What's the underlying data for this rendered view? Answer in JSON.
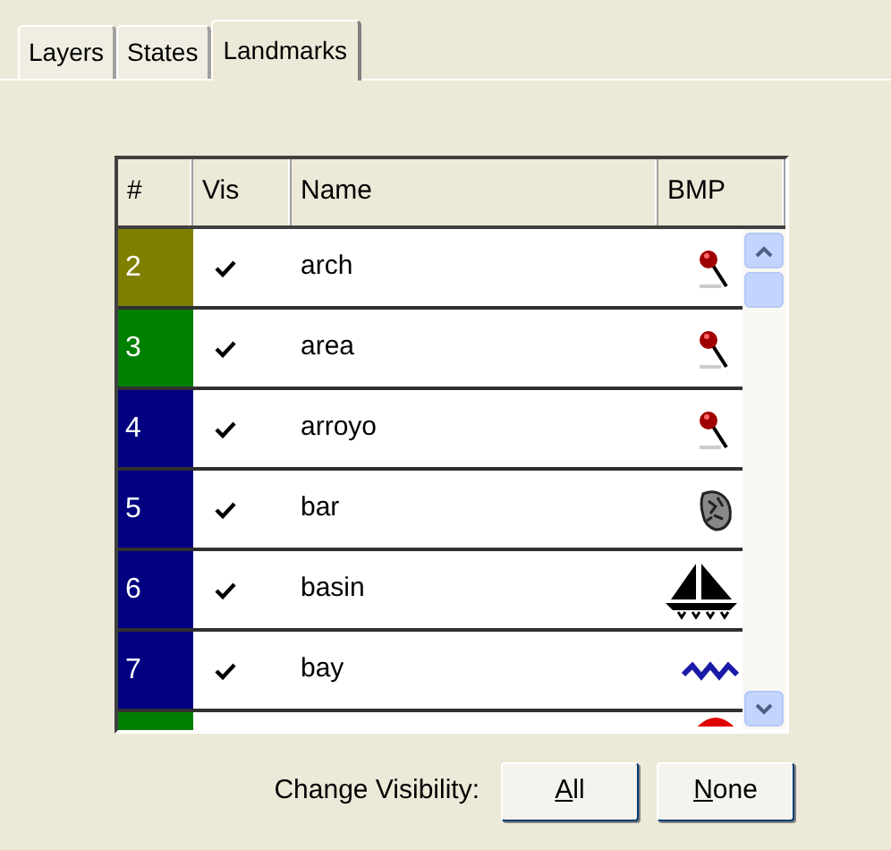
{
  "tabs": [
    {
      "label": "Layers",
      "selected": false
    },
    {
      "label": "States",
      "selected": false
    },
    {
      "label": "Landmarks",
      "selected": true
    }
  ],
  "table": {
    "columns": [
      "#",
      "Vis",
      "Name",
      "BMP"
    ],
    "rows": [
      {
        "number": "2",
        "color": "#808000",
        "visible": true,
        "name": "arch",
        "kind": "pin"
      },
      {
        "number": "3",
        "color": "#008000",
        "visible": true,
        "name": "area",
        "kind": "pin"
      },
      {
        "number": "4",
        "color": "#000080",
        "visible": true,
        "name": "arroyo",
        "kind": "pin"
      },
      {
        "number": "5",
        "color": "#000080",
        "visible": true,
        "name": "bar",
        "kind": "rock"
      },
      {
        "number": "6",
        "color": "#000080",
        "visible": true,
        "name": "basin",
        "kind": "boat"
      },
      {
        "number": "7",
        "color": "#000080",
        "visible": true,
        "name": "bay",
        "kind": "wave"
      },
      {
        "color": "#008000",
        "kind": "dome"
      }
    ]
  },
  "visibility": {
    "label": "Change Visibility:",
    "buttons": [
      {
        "label": "All",
        "underline_first": true
      },
      {
        "label": "None",
        "underline_first": true
      }
    ]
  }
}
